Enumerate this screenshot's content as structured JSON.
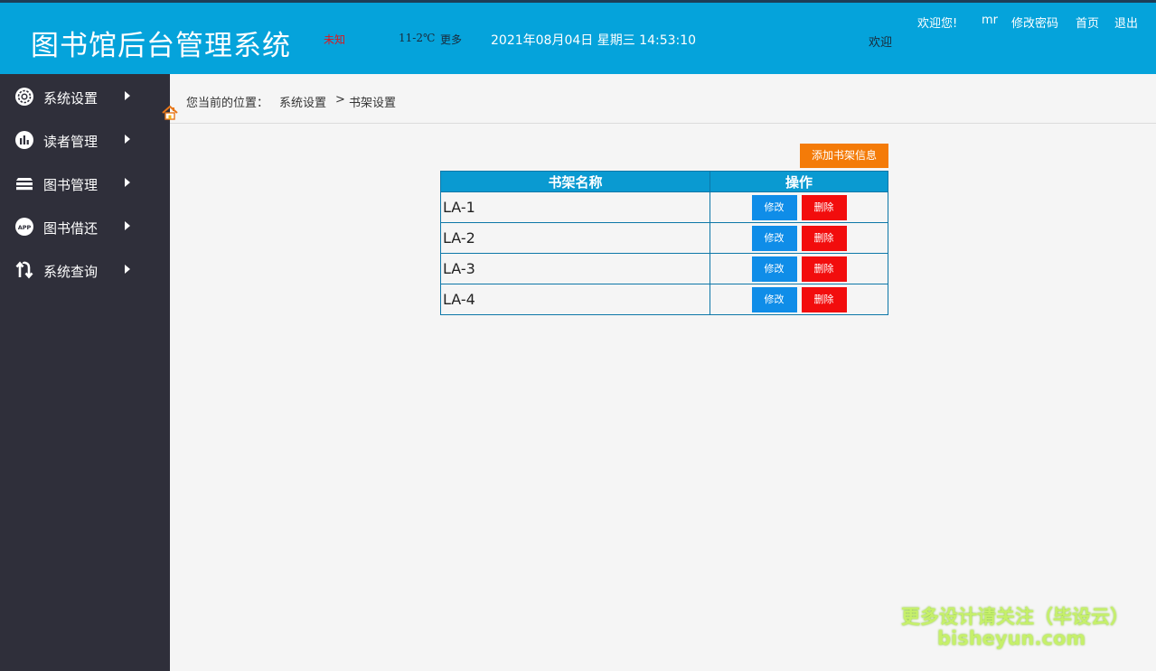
{
  "header": {
    "title": "图书馆后台管理系统",
    "weather_city": "未知",
    "weather_temp": "11-2℃",
    "weather_more": "更多",
    "datetime": "2021年08月04日 星期三 14:53:10",
    "marquee": "欢迎",
    "welcome": "欢迎您!",
    "username": "mr",
    "change_password": "修改密码",
    "home": "首页",
    "logout": "退出",
    "color": "#05a3db"
  },
  "sidebar": {
    "items": [
      {
        "label": "系统设置",
        "icon": "gear-icon"
      },
      {
        "label": "读者管理",
        "icon": "chart-icon"
      },
      {
        "label": "图书管理",
        "icon": "books-icon"
      },
      {
        "label": "图书借还",
        "icon": "app-icon"
      },
      {
        "label": "系统查询",
        "icon": "swap-icon"
      }
    ]
  },
  "breadcrumb": {
    "prefix": "您当前的位置：",
    "level1": "系统设置",
    "separator": ">",
    "level2": "书架设置"
  },
  "main": {
    "add_button": "添加书架信息",
    "table": {
      "headers": [
        "书架名称",
        "操作"
      ],
      "rows": [
        {
          "name": "LA-1",
          "edit": "修改",
          "delete": "删除"
        },
        {
          "name": "LA-2",
          "edit": "修改",
          "delete": "删除"
        },
        {
          "name": "LA-3",
          "edit": "修改",
          "delete": "删除"
        },
        {
          "name": "LA-4",
          "edit": "修改",
          "delete": "删除"
        }
      ]
    }
  },
  "watermark": {
    "line1": "更多设计请关注（毕设云）",
    "line2": "bisheyun.com"
  }
}
